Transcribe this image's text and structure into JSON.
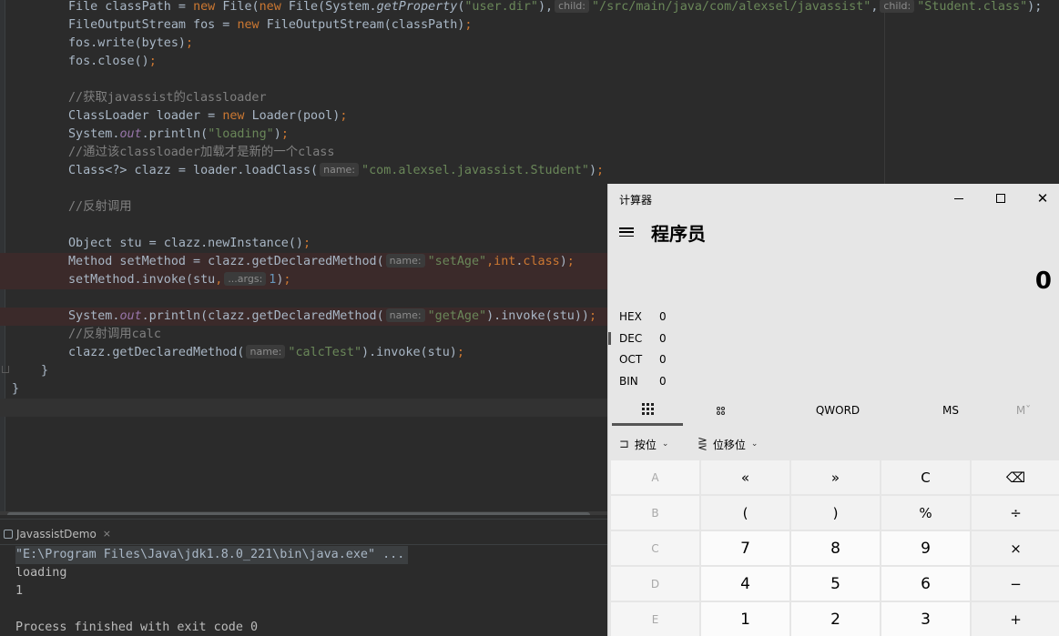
{
  "editor": {
    "lines": [
      {
        "id": "l1",
        "parts": [
          [
            "",
            "File classPath = "
          ],
          [
            "kw",
            "new "
          ],
          [
            "",
            "File("
          ],
          [
            "kw",
            "new "
          ],
          [
            "",
            "File(System."
          ],
          [
            "it",
            "getProperty"
          ],
          [
            "",
            "("
          ],
          [
            "str",
            "\"user.dir\""
          ],
          [
            "",
            "),"
          ],
          [
            "hint",
            "child:"
          ],
          [
            "str",
            "\"/src/main/java/com/alexsel/javassist\""
          ],
          [
            "",
            ","
          ],
          [
            "hint",
            "child:"
          ],
          [
            "str",
            "\"Student.class\""
          ],
          [
            "",
            ");"
          ]
        ]
      },
      {
        "id": "l2",
        "parts": [
          [
            "",
            "FileOutputStream fos = "
          ],
          [
            "kw",
            "new "
          ],
          [
            "",
            "FileOutputStream(classPath)"
          ],
          [
            "kw",
            ";"
          ]
        ]
      },
      {
        "id": "l3",
        "parts": [
          [
            "",
            "fos.write(bytes)"
          ],
          [
            "kw",
            ";"
          ]
        ]
      },
      {
        "id": "l4",
        "parts": [
          [
            "",
            "fos.close()"
          ],
          [
            "kw",
            ";"
          ]
        ]
      },
      {
        "id": "l5",
        "parts": []
      },
      {
        "id": "l6",
        "parts": [
          [
            "cm",
            "//获取javassist的classloader"
          ]
        ]
      },
      {
        "id": "l7",
        "parts": [
          [
            "",
            "ClassLoader loader = "
          ],
          [
            "kw",
            "new "
          ],
          [
            "",
            "Loader(pool)"
          ],
          [
            "kw",
            ";"
          ]
        ]
      },
      {
        "id": "l8",
        "parts": [
          [
            "",
            "System."
          ],
          [
            "fld",
            "out"
          ],
          [
            "",
            ".println("
          ],
          [
            "str",
            "\"loading\""
          ],
          [
            "",
            ")"
          ],
          [
            "kw",
            ";"
          ]
        ]
      },
      {
        "id": "l9",
        "parts": [
          [
            "cm",
            "//通过该classloader加载才是新的一个class"
          ]
        ]
      },
      {
        "id": "l10",
        "parts": [
          [
            "",
            "Class<?> clazz = loader.loadClass("
          ],
          [
            "hint",
            "name:"
          ],
          [
            "str",
            "\"com.alexsel.javassist.Student\""
          ],
          [
            "",
            ")"
          ],
          [
            "kw",
            ";"
          ]
        ]
      },
      {
        "id": "l11",
        "parts": []
      },
      {
        "id": "l12",
        "parts": [
          [
            "cm",
            "//反射调用"
          ]
        ]
      },
      {
        "id": "l13",
        "parts": []
      },
      {
        "id": "l14",
        "parts": [
          [
            "",
            "Object stu = clazz.newInstance()"
          ],
          [
            "kw",
            ";"
          ]
        ]
      },
      {
        "id": "l15",
        "parts": [
          [
            "",
            "Method setMethod = clazz.getDeclaredMethod("
          ],
          [
            "hint",
            "name:"
          ],
          [
            "str",
            "\"setAge\""
          ],
          [
            "kw",
            ",int"
          ],
          [
            "",
            "."
          ],
          [
            "kw",
            "class"
          ],
          [
            "",
            ")"
          ],
          [
            "kw",
            ";"
          ]
        ]
      },
      {
        "id": "l16",
        "parts": [
          [
            "",
            "setMethod.invoke(stu"
          ],
          [
            "kw",
            ","
          ],
          [
            "hint",
            "...args:"
          ],
          [
            "num",
            "1"
          ],
          [
            "",
            ")"
          ],
          [
            "kw",
            ";"
          ]
        ]
      },
      {
        "id": "l17",
        "parts": []
      },
      {
        "id": "l18",
        "parts": [
          [
            "",
            "System."
          ],
          [
            "fld",
            "out"
          ],
          [
            "",
            ".println(clazz.getDeclaredMethod("
          ],
          [
            "hint",
            "name:"
          ],
          [
            "str",
            "\"getAge\""
          ],
          [
            "",
            ").invoke(stu))"
          ],
          [
            "kw",
            ";"
          ]
        ]
      },
      {
        "id": "l19",
        "parts": [
          [
            "cm",
            "//反射调用calc"
          ]
        ]
      },
      {
        "id": "l20",
        "parts": [
          [
            "",
            "clazz.getDeclaredMethod("
          ],
          [
            "hint",
            "name:"
          ],
          [
            "str",
            "\"calcTest\""
          ],
          [
            "",
            ").invoke(stu)"
          ],
          [
            "kw",
            ";"
          ]
        ]
      },
      {
        "id": "l21",
        "parts": [
          [
            "",
            "}"
          ]
        ]
      },
      {
        "id": "l22",
        "parts": [
          [
            "",
            "}"
          ]
        ]
      },
      {
        "id": "l23",
        "parts": []
      }
    ]
  },
  "run_panel": {
    "tab_label": "JavassistDemo",
    "tab_close": "×",
    "console": [
      "\"E:\\Program Files\\Java\\jdk1.8.0_221\\bin\\java.exe\" ...",
      "loading",
      "1",
      "",
      "Process finished with exit code 0"
    ]
  },
  "calculator": {
    "title": "计算器",
    "minimize": "—",
    "maximize": "□",
    "close": "✕",
    "mode": "程序员",
    "display": "0",
    "bases": [
      {
        "label": "HEX",
        "value": "0"
      },
      {
        "label": "DEC",
        "value": "0"
      },
      {
        "label": "OCT",
        "value": "0"
      },
      {
        "label": "BIN",
        "value": "0"
      }
    ],
    "tabs": {
      "qword": "QWORD",
      "ms": "MS",
      "mplus": "Mˇ"
    },
    "tools": {
      "bitwise": "按位",
      "bitshift": "位移位"
    },
    "keys": [
      [
        "A",
        "«",
        "»",
        "C",
        "⌫"
      ],
      [
        "B",
        "(",
        ")",
        "%",
        "÷"
      ],
      [
        "C",
        "7",
        "8",
        "9",
        "×"
      ],
      [
        "D",
        "4",
        "5",
        "6",
        "−"
      ],
      [
        "E",
        "1",
        "2",
        "3",
        "+"
      ]
    ]
  }
}
